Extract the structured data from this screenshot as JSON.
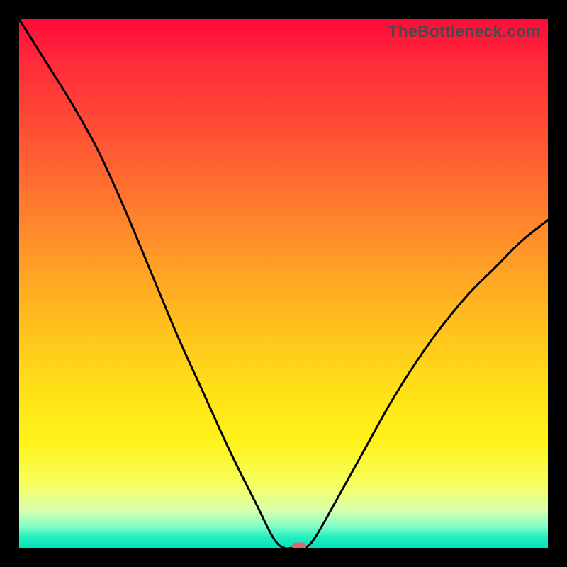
{
  "watermark": "TheBottleneck.com",
  "chart_data": {
    "type": "line",
    "title": "",
    "xlabel": "",
    "ylabel": "",
    "xlim": [
      0,
      100
    ],
    "ylim": [
      0,
      100
    ],
    "series": [
      {
        "name": "bottleneck-curve",
        "x": [
          0,
          5,
          10,
          15,
          20,
          25,
          30,
          35,
          40,
          45,
          48,
          50,
          52,
          54,
          56,
          60,
          65,
          70,
          75,
          80,
          85,
          90,
          95,
          100
        ],
        "y": [
          100,
          92,
          84,
          75,
          64,
          52,
          40,
          29,
          18,
          8,
          2,
          0,
          0,
          0,
          2,
          9,
          18,
          27,
          35,
          42,
          48,
          53,
          58,
          62
        ]
      }
    ],
    "marker": {
      "x": 53,
      "y": 0,
      "color": "#d96a6f"
    },
    "gradient_stops": [
      {
        "pos": 0,
        "color": "#ff0a3a"
      },
      {
        "pos": 25,
        "color": "#ff5a33"
      },
      {
        "pos": 55,
        "color": "#ffb81f"
      },
      {
        "pos": 80,
        "color": "#fff31a"
      },
      {
        "pos": 100,
        "color": "#00e4b8"
      }
    ]
  }
}
